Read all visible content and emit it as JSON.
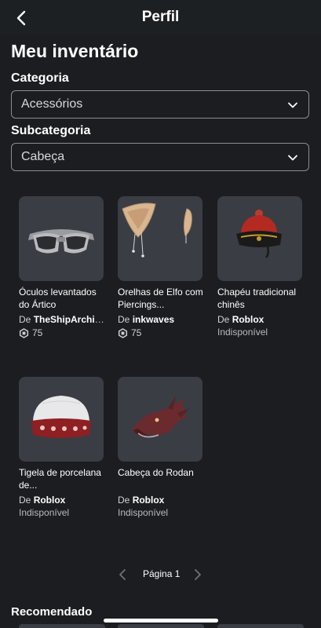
{
  "header": {
    "title": "Perfil",
    "back_icon": "chevron-left-icon"
  },
  "page": {
    "title": "Meu inventário"
  },
  "filters": {
    "category_label": "Categoria",
    "category_value": "Acessórios",
    "subcategory_label": "Subcategoria",
    "subcategory_value": "Cabeça"
  },
  "items": [
    {
      "name": "Óculos levantados do Ártico",
      "creator_prefix": "De",
      "creator": "TheShipArchit...",
      "price": "75",
      "icon": "goggles"
    },
    {
      "name": "Orelhas de Elfo com Piercings...",
      "creator_prefix": "De",
      "creator": "inkwaves",
      "price": "75",
      "icon": "elf-ears"
    },
    {
      "name": "Chapéu tradicional chinês",
      "creator_prefix": "De",
      "creator": "Roblox",
      "status": "Indisponível",
      "icon": "chinese-hat"
    },
    {
      "name": "Tigela de porcelana de...",
      "creator_prefix": "De",
      "creator": "Roblox",
      "status": "Indisponível",
      "icon": "porcelain-bowl"
    },
    {
      "name": "Cabeça do Rodan",
      "creator_prefix": "De",
      "creator": "Roblox",
      "status": "Indisponível",
      "icon": "rodan-head"
    }
  ],
  "pagination": {
    "label": "Página 1"
  },
  "recommended": {
    "title": "Recomendado"
  },
  "colors": {
    "background": "#1c1d21",
    "card": "#3b3d44",
    "border": "#8b8d90"
  }
}
